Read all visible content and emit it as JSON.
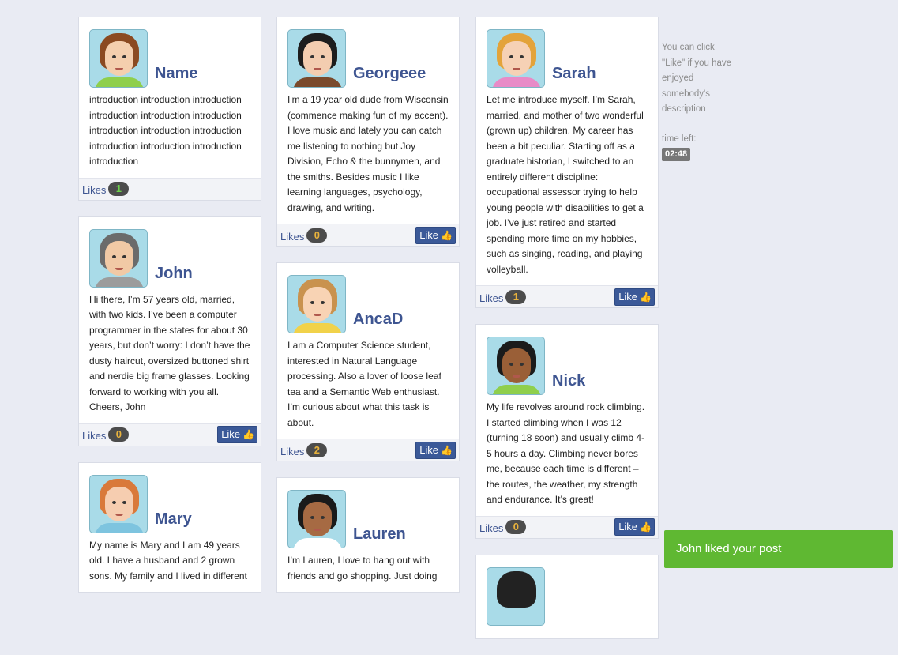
{
  "posts": [
    {
      "name": "Name",
      "likes": "1",
      "desc": "introduction introduction introduction introduction introduction introduction introduction introduction introduction introduction introduction introduction introduction",
      "hair": "#8b4a21",
      "skin": "#f4cfae",
      "shirt": "#8fcf4c",
      "show_like": false,
      "count_style": "green"
    },
    {
      "name": "John",
      "likes": "0",
      "desc": "Hi there, I’m 57 years old, married, with two kids. I’ve been a computer programmer in the states for about 30 years, but don’t worry: I don’t have the dusty haircut, oversized buttoned shirt and nerdie big frame glasses. Looking forward to working with you all. Cheers, John",
      "hair": "#6b6b6b",
      "skin": "#f1c9a5",
      "shirt": "#9c9c9c",
      "show_like": true
    },
    {
      "name": "Mary",
      "likes": "",
      "desc": "My name is Mary and I am 49 years old. I have a husband and 2 grown sons. My family and I lived in different",
      "hair": "#d9793a",
      "skin": "#f6cdb0",
      "shirt": "#7ec4df",
      "show_like": true
    },
    {
      "name": "Georgeee",
      "likes": "0",
      "desc": "I'm a 19 year old dude from Wisconsin (commence making fun of my accent). I love music and lately you can catch me listening to nothing but Joy Division, Echo & the bunnymen, and the smiths. Besides music I like learning languages, psychology, drawing, and writing.",
      "hair": "#1d1d1d",
      "skin": "#f3cdb0",
      "shirt": "#7a4a2c",
      "show_like": true
    },
    {
      "name": "AncaD",
      "likes": "2",
      "desc": "I am a Computer Science student, interested in Natural Language processing. Also a lover of loose leaf tea and a Semantic Web enthusiast. I’m curious about what this task is about.",
      "hair": "#c9924e",
      "skin": "#f8d3b4",
      "shirt": "#f1d24a",
      "show_like": true
    },
    {
      "name": "Lauren",
      "likes": "",
      "desc": "I’m Lauren, I love to hang out with friends and go shopping. Just doing",
      "hair": "#1a1a1a",
      "skin": "#a66a43",
      "shirt": "#ffffff",
      "show_like": true
    },
    {
      "name": "Sarah",
      "likes": "1",
      "desc": "Let me introduce myself. I’m Sarah, married, and mother of two wonderful (grown up) children. My career has been a bit peculiar. Starting off as a graduate historian, I switched to an entirely different discipline: occupational assessor trying to help young people with disabilities to get a job. I’ve just retired and started spending more time on my hobbies, such as singing, reading, and playing volleyball.",
      "hair": "#e3a33a",
      "skin": "#f6d1b5",
      "shirt": "#e88bc7",
      "show_like": true
    },
    {
      "name": "Nick",
      "likes": "0",
      "desc": "My life revolves around rock climbing. I started climbing when I was 12 (turning 18 soon) and usually climb 4-5 hours a day. Climbing never bores me, because each time is different – the routes, the weather, my strength and endurance. It’s great!",
      "hair": "#1b1b1b",
      "skin": "#9a5f37",
      "shirt": "#8fcf4c",
      "show_like": true
    }
  ],
  "ui": {
    "likes_label": "Likes",
    "like_button": "Like",
    "sidebar_hint": "You can click \"Like\" if you have enjoyed somebody's description",
    "time_label": "time left:",
    "timer": "02:48",
    "toast": "John liked your post"
  }
}
